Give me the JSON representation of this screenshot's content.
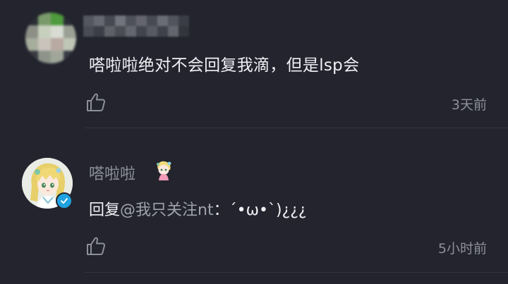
{
  "comments": [
    {
      "user": {
        "name": "",
        "avatar": "pixelated-avatar",
        "name_obscured": true
      },
      "text": "嗒啦啦绝对不会回复我滴，但是lsp会",
      "like_icon": "thumbs-up-icon",
      "time": "3天前"
    },
    {
      "user": {
        "name": "嗒啦啦",
        "avatar": "anime-girl-avatar",
        "verified": true,
        "medal_icon": "chibi-medal-icon"
      },
      "reply": {
        "prefix": "回复",
        "mention": "@我只关注nt",
        "separator": "：",
        "body": "´•ω•`)¿¿¿"
      },
      "like_icon": "thumbs-up-icon",
      "time": "5小时前"
    }
  ],
  "colors": {
    "background": "#23242e",
    "primary_text": "#f0f0f4",
    "secondary_text": "#8d8f9a",
    "divider": "#33343f",
    "verified_badge": "#1fa3e0"
  }
}
